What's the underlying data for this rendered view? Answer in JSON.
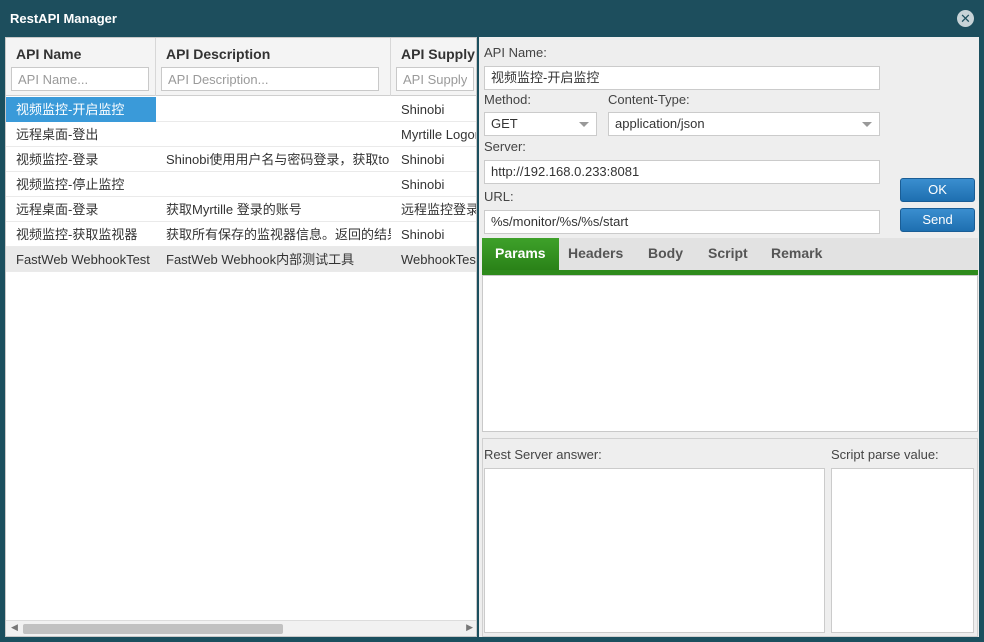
{
  "window": {
    "title": "RestAPI Manager"
  },
  "grid": {
    "columns": [
      {
        "label": "API Name",
        "placeholder": "API Name..."
      },
      {
        "label": "API Description",
        "placeholder": "API Description..."
      },
      {
        "label": "API Supply",
        "placeholder": "API Supply..."
      }
    ],
    "rows": [
      {
        "name": "视频监控-开启监控",
        "desc": "",
        "supply": "Shinobi"
      },
      {
        "name": "远程桌面-登出",
        "desc": "",
        "supply": "Myrtille Logon"
      },
      {
        "name": "视频监控-登录",
        "desc": "Shinobi使用用户名与密码登录，获取to",
        "supply": "Shinobi"
      },
      {
        "name": "视频监控-停止监控",
        "desc": "",
        "supply": "Shinobi"
      },
      {
        "name": "远程桌面-登录",
        "desc": "获取Myrtille 登录的账号",
        "supply": "远程监控登录"
      },
      {
        "name": "视频监控-获取监视器",
        "desc": "获取所有保存的监视器信息。返回的结果",
        "supply": "Shinobi"
      },
      {
        "name": "FastWeb WebhookTest",
        "desc": "FastWeb Webhook内部测试工具",
        "supply": "WebhookTest"
      }
    ]
  },
  "form": {
    "api_name_label": "API Name:",
    "api_name_value": "视频监控-开启监控",
    "method_label": "Method:",
    "method_value": "GET",
    "content_type_label": "Content-Type:",
    "content_type_value": "application/json",
    "server_label": "Server:",
    "server_value": "http://192.168.0.233:8081",
    "url_label": "URL:",
    "url_value": "%s/monitor/%s/%s/start",
    "ok_label": "OK",
    "send_label": "Send"
  },
  "tabs": [
    "Params",
    "Headers",
    "Body",
    "Script",
    "Remark"
  ],
  "answer": {
    "rest_label": "Rest Server answer:",
    "script_label": "Script parse value:"
  },
  "colors": {
    "accent": "#2e8b1c",
    "selection": "#3a9ad9",
    "button": "#1e6fb0"
  }
}
